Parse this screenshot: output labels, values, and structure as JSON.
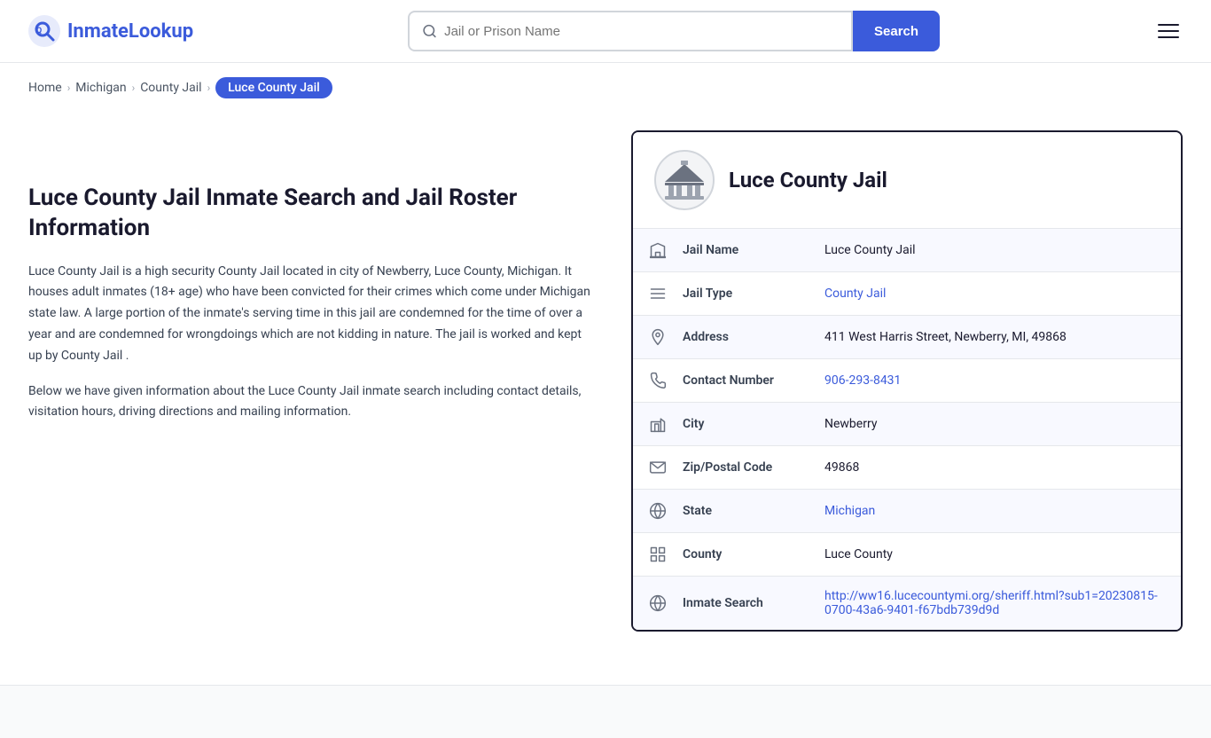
{
  "header": {
    "logo_text_start": "Inmate",
    "logo_text_end": "Lookup",
    "search_placeholder": "Jail or Prison Name",
    "search_button_label": "Search",
    "menu_label": "Menu"
  },
  "breadcrumb": {
    "home": "Home",
    "michigan": "Michigan",
    "county_jail": "County Jail",
    "active": "Luce County Jail"
  },
  "left": {
    "heading": "Luce County Jail Inmate Search and Jail Roster Information",
    "desc1": "Luce County Jail is a high security County Jail located in city of Newberry, Luce County, Michigan. It houses adult inmates (18+ age) who have been convicted for their crimes which come under Michigan state law. A large portion of the inmate's serving time in this jail are condemned for the time of over a year and are condemned for wrongdoings which are not kidding in nature. The jail is worked and kept up by County Jail .",
    "desc2": "Below we have given information about the Luce County Jail inmate search including contact details, visitation hours, driving directions and mailing information."
  },
  "card": {
    "title": "Luce County Jail",
    "rows": [
      {
        "icon": "building-icon",
        "label": "Jail Name",
        "value": "Luce County Jail",
        "link": null
      },
      {
        "icon": "list-icon",
        "label": "Jail Type",
        "value": "County Jail",
        "link": "#"
      },
      {
        "icon": "location-icon",
        "label": "Address",
        "value": "411 West Harris Street, Newberry, MI, 49868",
        "link": null
      },
      {
        "icon": "phone-icon",
        "label": "Contact Number",
        "value": "906-293-8431",
        "link": "tel:906-293-8431"
      },
      {
        "icon": "city-icon",
        "label": "City",
        "value": "Newberry",
        "link": null
      },
      {
        "icon": "mail-icon",
        "label": "Zip/Postal Code",
        "value": "49868",
        "link": null
      },
      {
        "icon": "globe-icon",
        "label": "State",
        "value": "Michigan",
        "link": "#"
      },
      {
        "icon": "county-icon",
        "label": "County",
        "value": "Luce County",
        "link": null
      },
      {
        "icon": "search-globe-icon",
        "label": "Inmate Search",
        "value": "http://ww16.lucecountymi.org/sheriff.html?sub1=20230815-0700-43a6-9401-f67bdb739d9d",
        "link": "http://ww16.lucecountymi.org/sheriff.html?sub1=20230815-0700-43a6-9401-f67bdb739d9d"
      }
    ]
  },
  "icons": {
    "building": "🏛",
    "list": "☰",
    "location": "📍",
    "phone": "📞",
    "city": "🏙",
    "mail": "✉",
    "globe": "🌐",
    "county": "🗺",
    "search_globe": "🌐"
  }
}
